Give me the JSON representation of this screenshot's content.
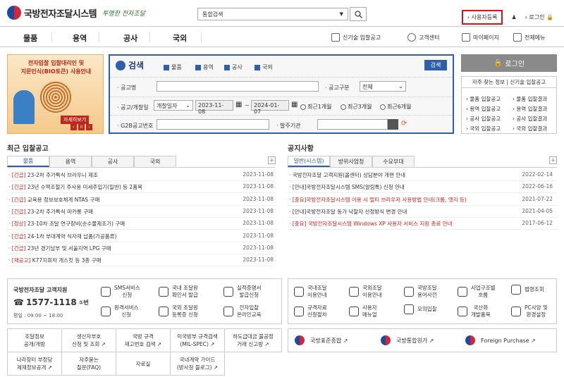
{
  "header": {
    "logo_title": "국방전자조달시스템",
    "logo_slogan": "투명한 전자조달",
    "search_select": "통합검색",
    "links": [
      "사용자등록",
      "로그인"
    ]
  },
  "gnb": {
    "menu": [
      "물품",
      "용역",
      "공사",
      "국외"
    ],
    "utils": [
      "신기술 입찰공고",
      "고객센터",
      "마이페이지",
      "전체메뉴"
    ]
  },
  "banner": {
    "title1": "전자입찰 입찰대리인 및",
    "title2": "지문인식(BIO토큰) 사용안내",
    "more": "자세히보기",
    "prev": "‹",
    "pause": "II",
    "next": "›"
  },
  "search": {
    "title": "검색",
    "button": "검색",
    "checks": [
      "물품",
      "용역",
      "공사",
      "국외"
    ],
    "notice_name_label": "공고명",
    "notice_type_label": "공고구분",
    "notice_type_value": "전체",
    "period_label": "공고/개찰일",
    "period_select": "개찰일자",
    "date_from": "2023-11-08",
    "date_to": "2024-01-07",
    "radios": [
      "최근1개월",
      "최근3개월",
      "최근6개월"
    ],
    "g2b_label": "G2B공고번호",
    "agency_label": "발주기관"
  },
  "login": {
    "button": "로그인",
    "quick_title": "자주 찾는 정보 | 신기술 입찰공고",
    "quick_items": [
      "물품 입찰공고",
      "물품 입찰결과",
      "용역 입찰공고",
      "용역 입찰결과",
      "공사 입찰공고",
      "공사 입찰결과",
      "국외 입찰공고",
      "국외 입찰결과"
    ]
  },
  "recent": {
    "title": "최근 입찰공고",
    "tabs": [
      "물품",
      "용역",
      "공사",
      "국외"
    ],
    "rows": [
      {
        "tag": "[긴급]",
        "text": " 23-2차 추가특식 브라우니 제조",
        "date": "2023-11-08"
      },
      {
        "tag": "[긴급]",
        "text": " 23년 수액조절기 주사용 미세주입기(일반) 등 2품목",
        "date": "2023-11-08"
      },
      {
        "tag": "[긴급]",
        "text": " 교육용 정보보호체계 NTAS 구매",
        "date": "2023-11-08"
      },
      {
        "tag": "[긴급]",
        "text": " 23-2차 추가특식 마카롱 구매",
        "date": "2023-11-08"
      },
      {
        "tag": "[정상]",
        "text": " 23-10차 조달 연구장비(순수물제조기) 구매",
        "date": "2023-11-08"
      },
      {
        "tag": "[긴급]",
        "text": " 24-1차 부대계약 식자재 납품(가공품류)",
        "date": "2023-11-08"
      },
      {
        "tag": "[긴급]",
        "text": " 23년 경기남부 및 서울지역 LPG 구매",
        "date": "2023-11-08"
      },
      {
        "tag": "[재공고]",
        "text": " K77지휘차 개스킷 등 3종 구매",
        "date": "2023-11-08"
      }
    ]
  },
  "notice": {
    "title": "공지사항",
    "tabs": [
      "일반(시스템)",
      "방위사업청",
      "수요부대"
    ],
    "rows": [
      {
        "text": "국방전자조달 고객지원(콜센터) 상담분야 개편 안내",
        "date": "2022-02-14",
        "red": false
      },
      {
        "text": "[안내]국방전자조달시스템 SMS(알림톡) 신청 안내",
        "date": "2022-06-16",
        "red": false
      },
      {
        "text": "[중요]국방전자조달시스템 이용 시 멀티 브라우저 사용방법 안내(크롬, 엣지 등)",
        "date": "2021-07-22",
        "red": true
      },
      {
        "text": "[안내]국방전자조달 동가 낙찰자 선정방식 변경 안내",
        "date": "2021-04-05",
        "red": false
      },
      {
        "text": "[중요] 국방전자조달시스템 Windows XP 사용자 서비스 지원 종료 안내",
        "date": "2017-06-12",
        "red": true
      }
    ]
  },
  "support": {
    "title": "국방전자조달 고객지원",
    "phone": "1577-1118",
    "phone_suffix": "①번",
    "hours": "평일 : 09:00 ~ 18:00",
    "items": [
      "SMS서비스\n신청",
      "국내 조달원\n확인서 발급",
      "실적증명서\n발급신청",
      "원격서비스\n신청",
      "국외 조달원\n등록증 신청",
      "전자입찰\n온라인교육"
    ],
    "items2": [
      "국내조달\n이용안내",
      "국외조달\n이용안내",
      "국방조달\n용어사전",
      "사업구조별\n흐름",
      "법령조회",
      "규격자료\n신청절차",
      "사용자\n메뉴얼",
      "모의입찰",
      "국산화\n개발품목",
      "PC사양 및\n환경설정"
    ]
  },
  "links": {
    "cells": [
      "조달정보\n공개/개방",
      "생산자부호\n신청 및 조회 ↗",
      "국방 규격\n재고번호 검색 ↗",
      "미국방부 규격검색\n(MIL-SPEC) ↗",
      "하도급대금 불공정\n거래 신고방 ↗",
      "나라장터 부정당\n제재정보공개 ↗",
      "자주묻는\n질문(FAQ)",
      "자료실",
      "국내계약 가이드\n(방사청 블로그) ↗"
    ],
    "family": [
      "국방표준종합 ↗",
      "국방통합원가 ↗",
      "Foreign Purchase ↗"
    ]
  }
}
